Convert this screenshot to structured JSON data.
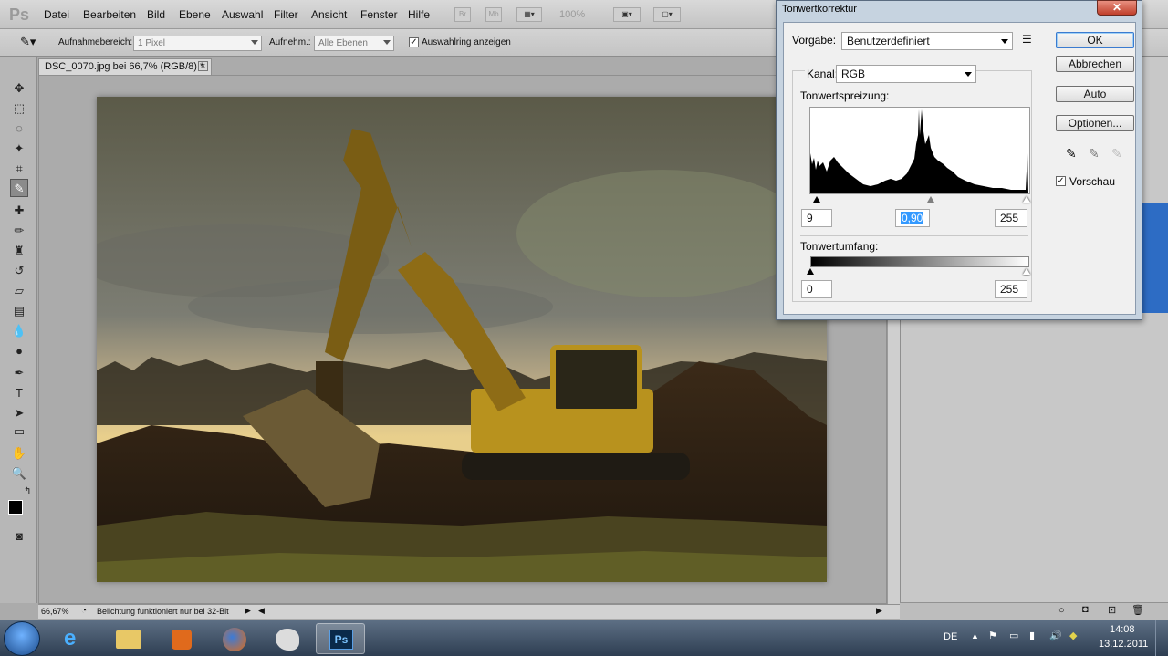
{
  "menubar": {
    "logo": "Ps",
    "items": [
      "Datei",
      "Bearbeiten",
      "Bild",
      "Ebene",
      "Auswahl",
      "Filter",
      "Ansicht",
      "Fenster",
      "Hilfe"
    ],
    "br": "Br",
    "mb": "Mb",
    "zoom": "100%"
  },
  "options": {
    "sample_size_label": "Aufnahmebereich:",
    "sample_size_value": "1 Pixel",
    "sample_label": "Aufnehm.:",
    "sample_value": "Alle Ebenen",
    "show_ring_label": "Auswahlring anzeigen"
  },
  "document": {
    "tab_title": "DSC_0070.jpg bei 66,7% (RGB/8) *",
    "close": "×"
  },
  "statusbar": {
    "zoom": "66,67%",
    "message": "Belichtung funktioniert nur bei 32-Bit"
  },
  "dialog": {
    "title": "Tonwertkorrektur",
    "close": "✕",
    "preset_label": "Vorgabe:",
    "preset_value": "Benutzerdefiniert",
    "channel_label": "Kanal:",
    "channel_value": "RGB",
    "input_levels_label": "Tonwertspreizung:",
    "input_black": "9",
    "input_gamma": "0,90",
    "input_white": "255",
    "output_levels_label": "Tonwertumfang:",
    "output_black": "0",
    "output_white": "255",
    "buttons": {
      "ok": "OK",
      "cancel": "Abbrechen",
      "auto": "Auto",
      "options": "Optionen..."
    },
    "preview_label": "Vorschau",
    "preview_checked": true
  },
  "taskbar": {
    "lang": "DE",
    "time": "14:08",
    "date": "13.12.2011",
    "ps_label": "Ps"
  }
}
